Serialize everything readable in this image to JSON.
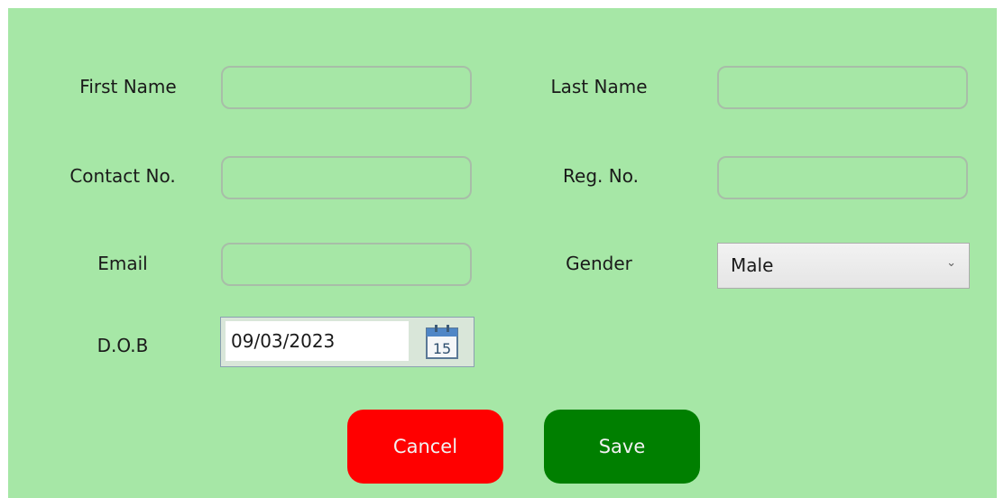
{
  "form": {
    "first_name": {
      "label": "First Name",
      "value": ""
    },
    "last_name": {
      "label": "Last Name",
      "value": ""
    },
    "contact_no": {
      "label": "Contact No.",
      "value": ""
    },
    "reg_no": {
      "label": "Reg. No.",
      "value": ""
    },
    "email": {
      "label": "Email",
      "value": ""
    },
    "gender": {
      "label": "Gender",
      "value": "Male"
    },
    "dob": {
      "label": "D.O.B",
      "value": "09/03/2023",
      "calendar_day": "15"
    }
  },
  "buttons": {
    "cancel_label": "Cancel",
    "save_label": "Save"
  },
  "colors": {
    "background": "#a6e7a6",
    "cancel": "#ff0000",
    "save": "#007f00"
  },
  "icons": {
    "dropdown": "chevron-down-icon",
    "calendar": "calendar-icon"
  }
}
